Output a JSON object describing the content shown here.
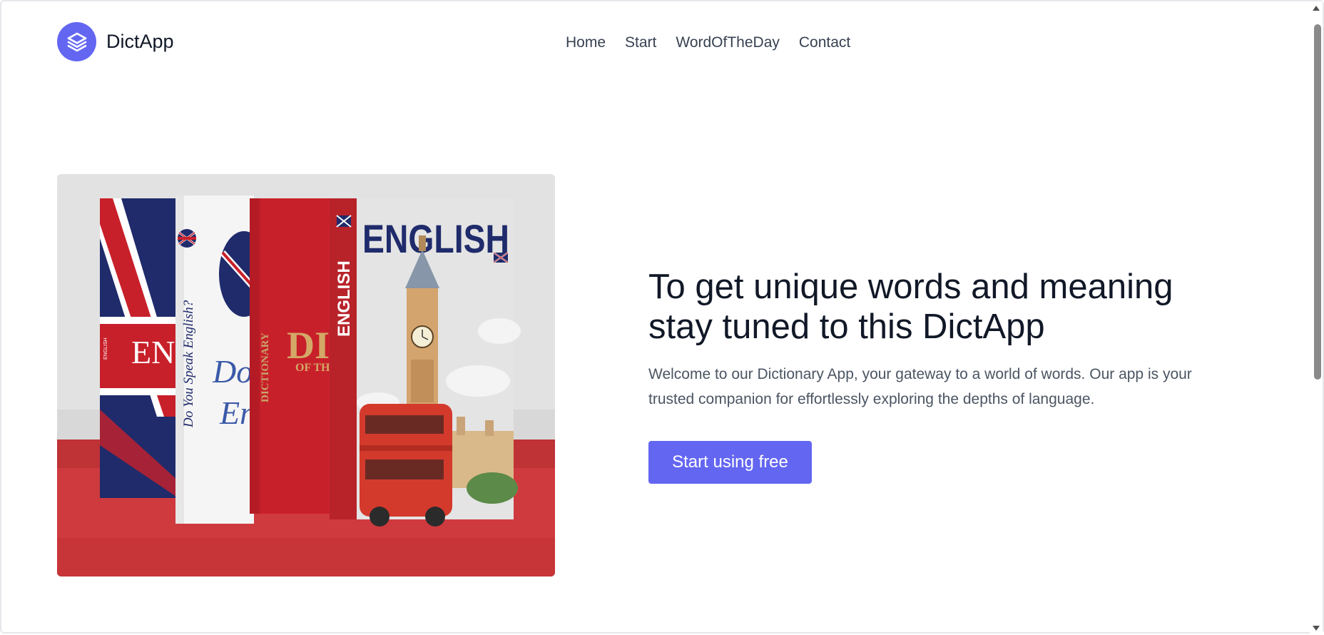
{
  "header": {
    "logo_text": "DictApp",
    "logo_icon": "layers-icon",
    "nav": [
      "Home",
      "Start",
      "WordOfTheDay",
      "Contact"
    ]
  },
  "hero": {
    "title": "To get unique words and meaning stay tuned to this DictApp",
    "description": "Welcome to our Dictionary App, your gateway to a world of words. Our app is your trusted companion for effortlessly exploring the depths of language.",
    "cta_label": "Start using free",
    "image": {
      "book_cover_title": "ENGLISH",
      "spine_texts": [
        "ENGLISH",
        "Do You Speak English?",
        "DICTIONARY",
        "ENGLISH"
      ],
      "partial_texts": [
        "EN",
        "DIC",
        "OF THE",
        "Do",
        "Eng"
      ]
    }
  },
  "colors": {
    "accent": "#6366f1",
    "title": "#111827",
    "body_text": "#4b5563",
    "nav_text": "#374151"
  }
}
